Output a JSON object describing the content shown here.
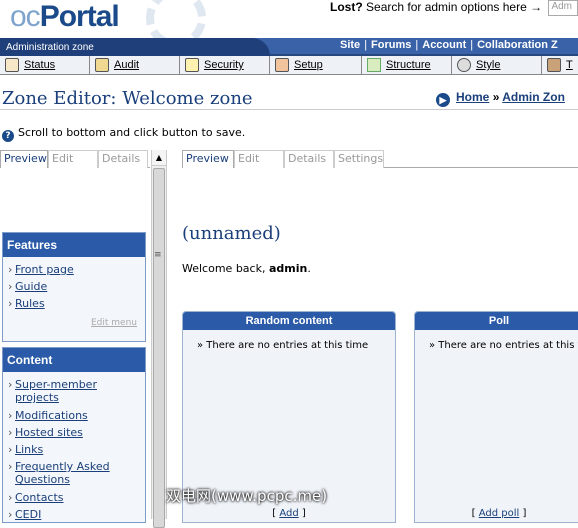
{
  "header": {
    "logo_prefix": "oc",
    "logo_main": "Portal",
    "lost_label": "Lost?",
    "lost_text": "Search for admin options here →",
    "search_placeholder": "Adm"
  },
  "topbar": {
    "zone_label": "Administration zone",
    "links": [
      "Site",
      "Forums",
      "Account",
      "Collaboration Z"
    ]
  },
  "menu": {
    "items": [
      "Status",
      "Audit",
      "Security",
      "Setup",
      "Structure",
      "Style",
      "T"
    ]
  },
  "page": {
    "title": "Zone Editor: Welcome zone",
    "breadcrumb_home": "Home",
    "breadcrumb_sep": "»",
    "breadcrumb_current": "Admin Zon",
    "hint": "Scroll to bottom and click button to save."
  },
  "left_tabs": [
    "Preview",
    "Edit",
    "Details"
  ],
  "main_tabs": [
    "Preview",
    "Edit",
    "Details",
    "Settings"
  ],
  "features": {
    "title": "Features",
    "items": [
      "Front page",
      "Guide",
      "Rules"
    ],
    "edit_menu": "Edit menu"
  },
  "content": {
    "title": "Content",
    "items": [
      "Super-member projects",
      "Modifications",
      "Hosted sites",
      "Links",
      "Frequently Asked Questions",
      "Contacts",
      "CEDI"
    ]
  },
  "main": {
    "zone_name": "(unnamed)",
    "welcome_prefix": "Welcome back, ",
    "username": "admin",
    "welcome_suffix": "."
  },
  "blocks": [
    {
      "title": "Random content",
      "text": "» There are no entries at this time",
      "footer_link": "Add"
    },
    {
      "title": "Poll",
      "text": "» There are no entries at this t",
      "footer_link": "Add poll"
    }
  ],
  "watermark": "双电网(www.pcpc.me)",
  "colors": {
    "accent": "#2b5ba8",
    "dark_nav": "#1f3f7a",
    "link": "#1a3f7a"
  }
}
